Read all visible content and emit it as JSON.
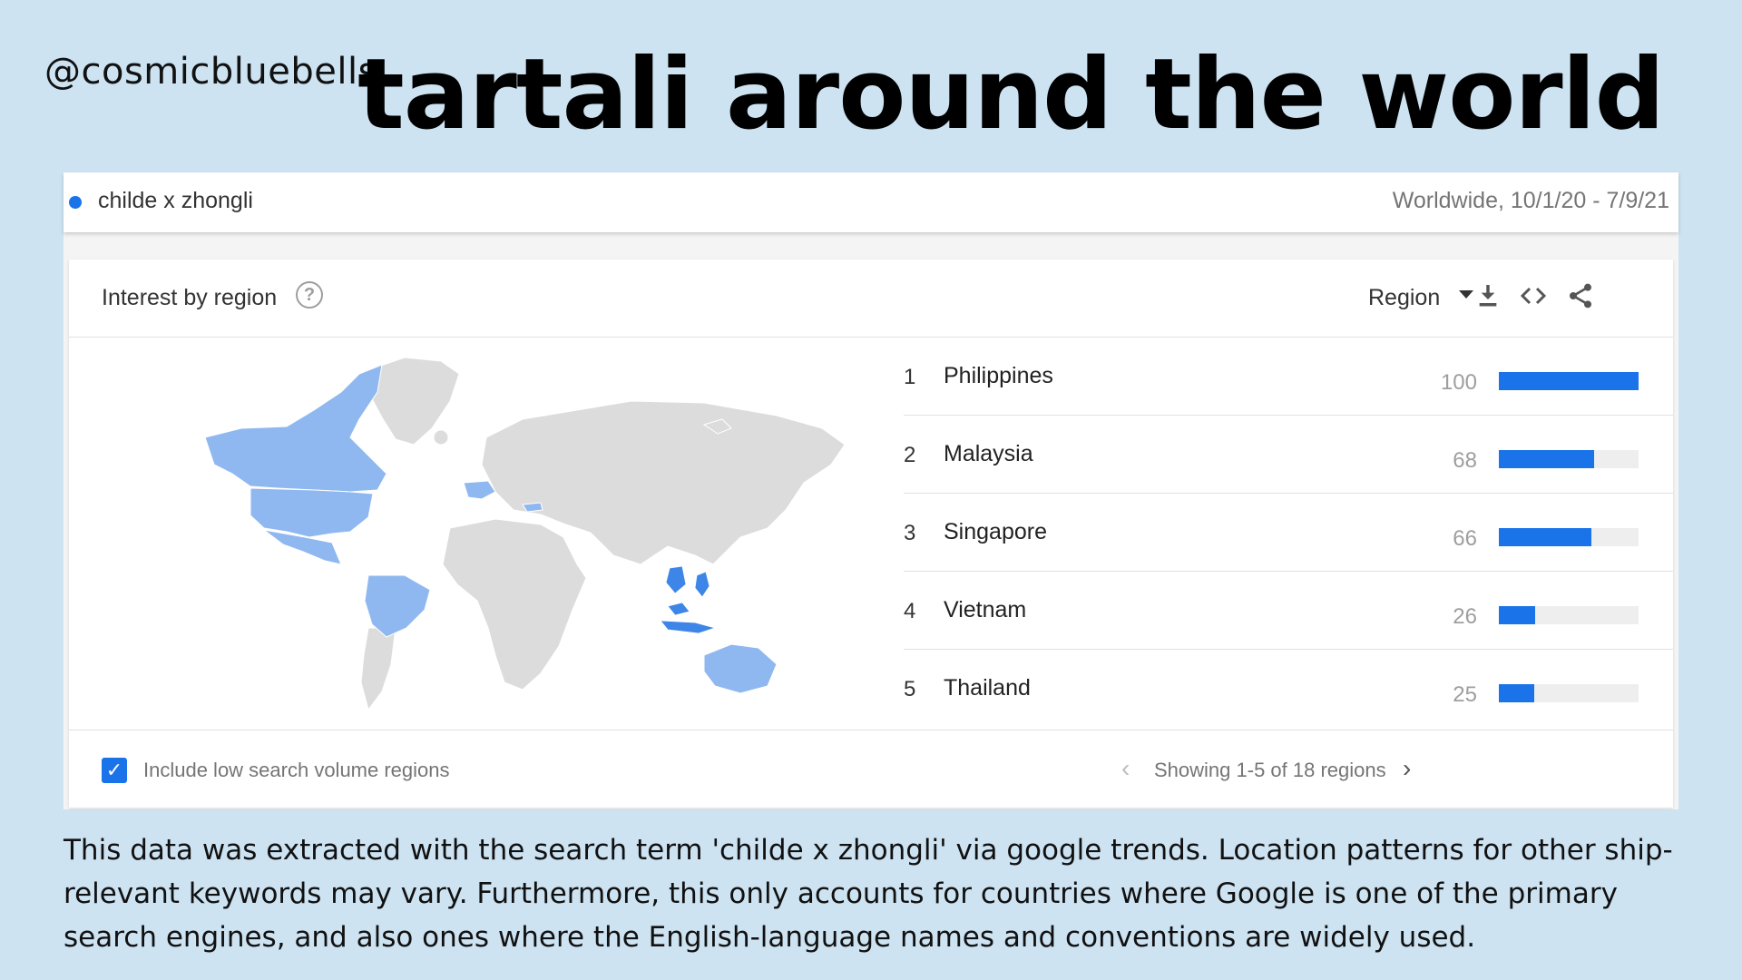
{
  "handle": "@cosmicbluebells",
  "title": "tartali around the world",
  "term": {
    "label": "childe x zhongli",
    "range": "Worldwide, 10/1/20 - 7/9/21",
    "color": "#1a73e8"
  },
  "card": {
    "title": "Interest by region",
    "help_icon": "help-circle-icon",
    "resolution_label": "Region",
    "tools": [
      "download-icon",
      "embed-code-icon",
      "share-icon"
    ]
  },
  "regions": [
    {
      "rank": "1",
      "name": "Philippines",
      "value": 100
    },
    {
      "rank": "2",
      "name": "Malaysia",
      "value": 68
    },
    {
      "rank": "3",
      "name": "Singapore",
      "value": 66
    },
    {
      "rank": "4",
      "name": "Vietnam",
      "value": 26
    },
    {
      "rank": "5",
      "name": "Thailand",
      "value": 25
    }
  ],
  "footer": {
    "checkbox_checked": true,
    "checkbox_label": "Include low search volume regions",
    "pager_text": "Showing 1-5 of 18 regions"
  },
  "colors": {
    "background": "#cde3f2",
    "accent": "#1a73e8",
    "map_highlight": "#8fb8f0",
    "map_base": "#dcdcdc"
  },
  "footnote": "This data was extracted with the search term 'childe x zhongli' via google trends. Location patterns for other ship-relevant keywords may vary. Furthermore, this only accounts for countries where Google is one of the primary search engines, and also ones where the English-language names and conventions are widely used."
}
